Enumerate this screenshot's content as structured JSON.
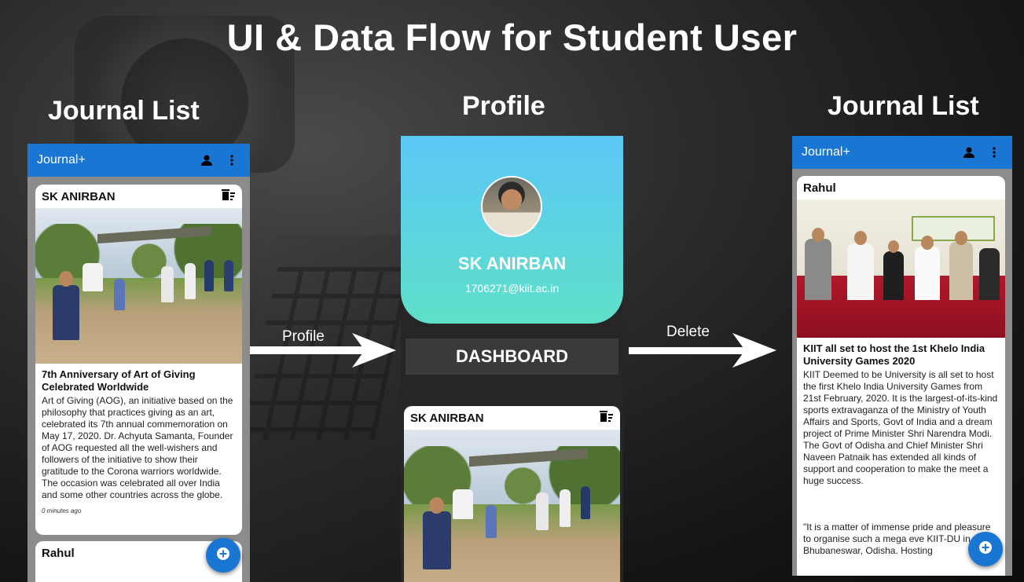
{
  "title": "UI & Data Flow for Student User",
  "sections": {
    "left": "Journal List",
    "middle": "Profile",
    "right": "Journal List"
  },
  "arrows": {
    "profile": "Profile",
    "delete": "Delete"
  },
  "app_name": "Journal+",
  "left_screen": {
    "card1": {
      "author": "SK ANIRBAN",
      "headline": "7th Anniversary of Art of Giving Celebrated Worldwide",
      "description": "Art of Giving (AOG), an initiative based on the philosophy that practices giving as an art, celebrated its 7th annual commemoration on May 17, 2020. Dr. Achyuta Samanta, Founder of AOG requested all the well-wishers and followers of the initiative to show their gratitude to the Corona warriors worldwide. The occasion was celebrated all over India and some other countries across the globe.",
      "time": "0 minutes ago"
    },
    "card2": {
      "author": "Rahul"
    }
  },
  "profile_screen": {
    "name": "SK ANIRBAN",
    "email": "1706271@kiit.ac.in",
    "dashboard": "DASHBOARD",
    "card": {
      "author": "SK ANIRBAN"
    }
  },
  "right_screen": {
    "card": {
      "author": "Rahul",
      "headline": "KIIT all set to host the 1st Khelo India University Games 2020",
      "description": "KIIT Deemed to be University is all set to host the first Khelo India University Games from 21st February, 2020. It is the largest-of-its-kind sports extravaganza of the Ministry of Youth Affairs and Sports, Govt of India and a dream project of Prime Minister Shri Narendra Modi. The Govt of Odisha and Chief Minister Shri Naveen Patnaik has extended all kinds of support and cooperation to make the meet a huge success.",
      "quote": "\"It is a matter of immense pride and pleasure to organise such a mega eve KIIT-DU in Bhubaneswar, Odisha. Hosting"
    }
  },
  "icons": {
    "account": "account-icon",
    "more": "more-vert-icon",
    "delete": "delete-sweep-icon",
    "add": "add-circle-icon"
  },
  "colors": {
    "appbar": "#1976d2",
    "profile_gradient_top": "#5bc7f7",
    "profile_gradient_bottom": "#5fe0c9"
  }
}
